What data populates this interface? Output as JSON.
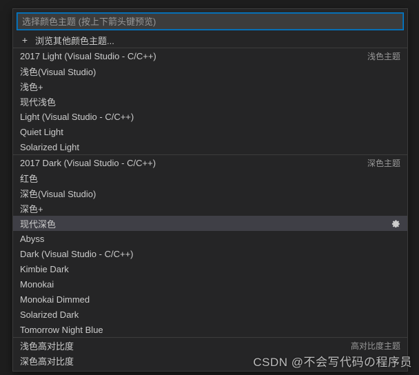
{
  "search": {
    "placeholder": "选择颜色主题 (按上下箭头键预览)"
  },
  "browse": {
    "label": "浏览其他颜色主题..."
  },
  "groups": {
    "light_label": "浅色主题",
    "light_items": [
      "2017 Light (Visual Studio - C/C++)",
      "浅色(Visual Studio)",
      "浅色+",
      "现代浅色",
      "Light (Visual Studio - C/C++)",
      "Quiet Light",
      "Solarized Light"
    ],
    "dark_label": "深色主题",
    "dark_items": [
      "2017 Dark (Visual Studio - C/C++)",
      "红色",
      "深色(Visual Studio)",
      "深色+",
      "现代深色",
      "Abyss",
      "Dark (Visual Studio - C/C++)",
      "Kimbie Dark",
      "Monokai",
      "Monokai Dimmed",
      "Solarized Dark",
      "Tomorrow Night Blue"
    ],
    "hc_label": "高对比度主题",
    "hc_items": [
      "浅色高对比度",
      "深色高对比度"
    ]
  },
  "selected": "现代深色",
  "watermark": "CSDN @不会写代码の程序员"
}
